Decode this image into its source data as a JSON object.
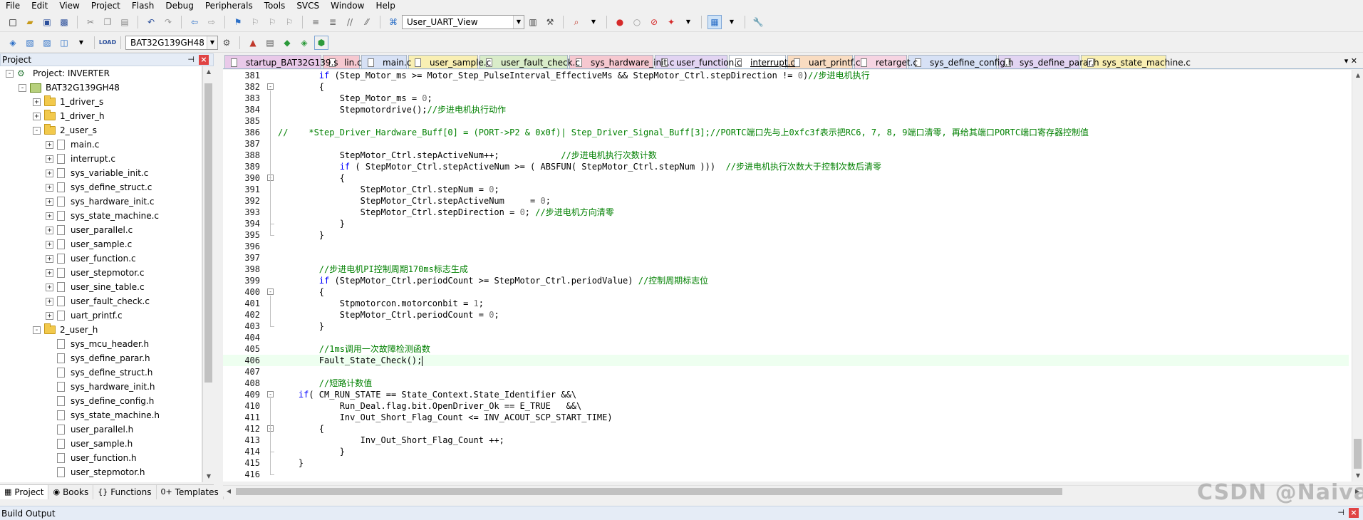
{
  "menu": [
    "File",
    "Edit",
    "View",
    "Project",
    "Flash",
    "Debug",
    "Peripherals",
    "Tools",
    "SVCS",
    "Window",
    "Help"
  ],
  "toolbar1": {
    "target_combo": "User_UART_View",
    "icons": [
      "new-file-icon",
      "open-file-icon",
      "save-icon",
      "save-all-icon",
      "cut-icon",
      "copy-icon",
      "paste-icon",
      "undo-icon",
      "redo-icon",
      "nav-back-icon",
      "nav-forward-icon",
      "bookmark-icon",
      "bookmark-prev-icon",
      "bookmark-next-icon",
      "bookmark-clear-icon",
      "indent-icon",
      "unindent-icon",
      "comment-icon",
      "uncomment-icon"
    ]
  },
  "toolbar2": {
    "target_combo": "BAT32G139GH48",
    "load_label": "LOAD"
  },
  "project_pane": {
    "title": "Project",
    "tree": [
      {
        "label": "Project: INVERTER",
        "level": 0,
        "kind": "project",
        "expanded": "-"
      },
      {
        "label": "BAT32G139GH48",
        "level": 1,
        "kind": "target",
        "expanded": "-"
      },
      {
        "label": "1_driver_s",
        "level": 2,
        "kind": "folder",
        "expanded": "+"
      },
      {
        "label": "1_driver_h",
        "level": 2,
        "kind": "folder",
        "expanded": "+"
      },
      {
        "label": "2_user_s",
        "level": 2,
        "kind": "folder",
        "expanded": "-"
      },
      {
        "label": "main.c",
        "level": 3,
        "kind": "file",
        "expanded": "+"
      },
      {
        "label": "interrupt.c",
        "level": 3,
        "kind": "file",
        "expanded": "+"
      },
      {
        "label": "sys_variable_init.c",
        "level": 3,
        "kind": "file",
        "expanded": "+"
      },
      {
        "label": "sys_define_struct.c",
        "level": 3,
        "kind": "file",
        "expanded": "+"
      },
      {
        "label": "sys_hardware_init.c",
        "level": 3,
        "kind": "file",
        "expanded": "+"
      },
      {
        "label": "sys_state_machine.c",
        "level": 3,
        "kind": "file",
        "expanded": "+"
      },
      {
        "label": "user_parallel.c",
        "level": 3,
        "kind": "file",
        "expanded": "+"
      },
      {
        "label": "user_sample.c",
        "level": 3,
        "kind": "file",
        "expanded": "+"
      },
      {
        "label": "user_function.c",
        "level": 3,
        "kind": "file",
        "expanded": "+"
      },
      {
        "label": "user_stepmotor.c",
        "level": 3,
        "kind": "file",
        "expanded": "+"
      },
      {
        "label": "user_sine_table.c",
        "level": 3,
        "kind": "file",
        "expanded": "+"
      },
      {
        "label": "user_fault_check.c",
        "level": 3,
        "kind": "file",
        "expanded": "+"
      },
      {
        "label": "uart_printf.c",
        "level": 3,
        "kind": "file",
        "expanded": "+"
      },
      {
        "label": "2_user_h",
        "level": 2,
        "kind": "folder",
        "expanded": "-"
      },
      {
        "label": "sys_mcu_header.h",
        "level": 3,
        "kind": "file",
        "expanded": ""
      },
      {
        "label": "sys_define_parar.h",
        "level": 3,
        "kind": "file",
        "expanded": ""
      },
      {
        "label": "sys_define_struct.h",
        "level": 3,
        "kind": "file",
        "expanded": ""
      },
      {
        "label": "sys_hardware_init.h",
        "level": 3,
        "kind": "file",
        "expanded": ""
      },
      {
        "label": "sys_define_config.h",
        "level": 3,
        "kind": "file",
        "expanded": ""
      },
      {
        "label": "sys_state_machine.h",
        "level": 3,
        "kind": "file",
        "expanded": ""
      },
      {
        "label": "user_parallel.h",
        "level": 3,
        "kind": "file",
        "expanded": ""
      },
      {
        "label": "user_sample.h",
        "level": 3,
        "kind": "file",
        "expanded": ""
      },
      {
        "label": "user_function.h",
        "level": 3,
        "kind": "file",
        "expanded": ""
      },
      {
        "label": "user_stepmotor.h",
        "level": 3,
        "kind": "file",
        "expanded": ""
      }
    ]
  },
  "bottom_tabs": [
    {
      "label": "Project",
      "icon": "▦",
      "active": true
    },
    {
      "label": "Books",
      "icon": "◉",
      "active": false
    },
    {
      "label": "Functions",
      "icon": "{}",
      "active": false
    },
    {
      "label": "Templates",
      "icon": "0+",
      "active": false
    }
  ],
  "build_output": {
    "title": "Build Output"
  },
  "editor_tabs": [
    {
      "label": "startup_BAT32G139.s",
      "color": "#e9c9e9",
      "active": false
    },
    {
      "label": "lin.c",
      "color": "#f6c8d0",
      "active": false
    },
    {
      "label": "main.c",
      "color": "#d7e1f5",
      "active": false
    },
    {
      "label": "user_sample.c",
      "color": "#f9efb3",
      "active": false
    },
    {
      "label": "user_fault_check.c",
      "color": "#d9ecc9",
      "active": false
    },
    {
      "label": "sys_hardware_init.c",
      "color": "#f6c8d0",
      "active": false
    },
    {
      "label": "user_function.c",
      "color": "#e2d4f2",
      "active": false
    },
    {
      "label": "interrupt.c",
      "color": "#d5f0e4",
      "active": true
    },
    {
      "label": "uart_printf.c",
      "color": "#f9dcc1",
      "active": false
    },
    {
      "label": "retarget.c",
      "color": "#f6d4e2",
      "active": false
    },
    {
      "label": "sys_define_config.h",
      "color": "#d7e1f5",
      "active": false
    },
    {
      "label": "sys_define_parar.h",
      "color": "#e2d4f2",
      "active": false
    },
    {
      "label": "sys_state_machine.c",
      "color": "#f9efb3",
      "active": false
    }
  ],
  "code_lines": [
    {
      "n": "381",
      "fold": "",
      "segs": [
        [
          "        ",
          ""
        ],
        [
          "if",
          "k"
        ],
        [
          " (Step_Motor_ms >= Motor_Step_PulseInterval_EffectiveMs && StepMotor_Ctrl.stepDirection != ",
          ""
        ],
        [
          "0",
          "n"
        ],
        [
          ")",
          ""
        ],
        [
          "//步进电机执行",
          "c"
        ]
      ]
    },
    {
      "n": "382",
      "fold": "-",
      "segs": [
        [
          "        {",
          ""
        ]
      ]
    },
    {
      "n": "383",
      "fold": "",
      "segs": [
        [
          "            Step_Motor_ms = ",
          ""
        ],
        [
          "0",
          "n"
        ],
        [
          ";",
          ""
        ]
      ]
    },
    {
      "n": "384",
      "fold": "",
      "segs": [
        [
          "            Stepmotordrive();",
          ""
        ],
        [
          "//步进电机执行动作",
          "c"
        ]
      ]
    },
    {
      "n": "385",
      "fold": "",
      "segs": []
    },
    {
      "n": "386",
      "fold": "",
      "segs": [
        [
          "//    *Step_Driver_Hardware_Buff[0] = (PORT->P2 & 0x0f)| Step_Driver_Signal_Buff[3];//PORTC端口先与上0xfc3f表示把RC6, 7, 8, 9端口清零, 再给其端口PORTC端口寄存器控制值",
          "c"
        ]
      ]
    },
    {
      "n": "387",
      "fold": "",
      "segs": []
    },
    {
      "n": "388",
      "fold": "",
      "segs": [
        [
          "            StepMotor_Ctrl.stepActiveNum++;            ",
          ""
        ],
        [
          "//步进电机执行次数计数",
          "c"
        ]
      ]
    },
    {
      "n": "389",
      "fold": "",
      "segs": [
        [
          "            ",
          ""
        ],
        [
          "if",
          "k"
        ],
        [
          " ( StepMotor_Ctrl.stepActiveNum >= ( ABSFUN( StepMotor_Ctrl.stepNum )))  ",
          ""
        ],
        [
          "//步进电机执行次数大于控制次数后清零",
          "c"
        ]
      ]
    },
    {
      "n": "390",
      "fold": "-",
      "segs": [
        [
          "            {",
          ""
        ]
      ]
    },
    {
      "n": "391",
      "fold": "",
      "segs": [
        [
          "                StepMotor_Ctrl.stepNum = ",
          ""
        ],
        [
          "0",
          "n"
        ],
        [
          ";",
          ""
        ]
      ]
    },
    {
      "n": "392",
      "fold": "",
      "segs": [
        [
          "                StepMotor_Ctrl.stepActiveNum     = ",
          ""
        ],
        [
          "0",
          "n"
        ],
        [
          ";",
          ""
        ]
      ]
    },
    {
      "n": "393",
      "fold": "",
      "segs": [
        [
          "                StepMotor_Ctrl.stepDirection = ",
          ""
        ],
        [
          "0",
          "n"
        ],
        [
          "; ",
          ""
        ],
        [
          "//步进电机方向清零",
          "c"
        ]
      ]
    },
    {
      "n": "394",
      "fold": "",
      "segs": [
        [
          "            }",
          ""
        ]
      ]
    },
    {
      "n": "395",
      "fold": "",
      "segs": [
        [
          "        }",
          ""
        ]
      ]
    },
    {
      "n": "396",
      "fold": "",
      "segs": []
    },
    {
      "n": "397",
      "fold": "",
      "segs": []
    },
    {
      "n": "398",
      "fold": "",
      "segs": [
        [
          "        ",
          ""
        ],
        [
          "//步进电机PI控制周期170ms标志生成",
          "c"
        ]
      ]
    },
    {
      "n": "399",
      "fold": "",
      "segs": [
        [
          "        ",
          ""
        ],
        [
          "if",
          "k"
        ],
        [
          " (StepMotor_Ctrl.periodCount >= StepMotor_Ctrl.periodValue) ",
          ""
        ],
        [
          "//控制周期标志位",
          "c"
        ]
      ]
    },
    {
      "n": "400",
      "fold": "-",
      "segs": [
        [
          "        {",
          ""
        ]
      ]
    },
    {
      "n": "401",
      "fold": "",
      "segs": [
        [
          "            Stpmotorcon.motorconbit = ",
          ""
        ],
        [
          "1",
          "n"
        ],
        [
          ";",
          ""
        ]
      ]
    },
    {
      "n": "402",
      "fold": "",
      "segs": [
        [
          "            StepMotor_Ctrl.periodCount = ",
          ""
        ],
        [
          "0",
          "n"
        ],
        [
          ";",
          ""
        ]
      ]
    },
    {
      "n": "403",
      "fold": "",
      "segs": [
        [
          "        }",
          ""
        ]
      ]
    },
    {
      "n": "404",
      "fold": "",
      "segs": []
    },
    {
      "n": "405",
      "fold": "",
      "segs": [
        [
          "        ",
          ""
        ],
        [
          "//1ms调用一次故障检测函数",
          "c"
        ]
      ]
    },
    {
      "n": "406",
      "fold": "",
      "segs": [
        [
          "        Fault_State_Check();",
          ""
        ]
      ],
      "current": true
    },
    {
      "n": "407",
      "fold": "",
      "segs": []
    },
    {
      "n": "408",
      "fold": "",
      "segs": [
        [
          "        ",
          ""
        ],
        [
          "//短路计数值",
          "c"
        ]
      ]
    },
    {
      "n": "409",
      "fold": "-",
      "segs": [
        [
          "    ",
          ""
        ],
        [
          "if",
          "k"
        ],
        [
          "( CM_RUN_STATE == State_Context.State_Identifier &&\\",
          ""
        ]
      ]
    },
    {
      "n": "410",
      "fold": "",
      "segs": [
        [
          "            Run_Deal.flag.bit.OpenDriver_Ok == E_TRUE   &&\\",
          ""
        ]
      ]
    },
    {
      "n": "411",
      "fold": "",
      "segs": [
        [
          "            Inv_Out_Short_Flag_Count <= INV_ACOUT_SCP_START_TIME)",
          ""
        ]
      ]
    },
    {
      "n": "412",
      "fold": "-",
      "segs": [
        [
          "        {",
          ""
        ]
      ]
    },
    {
      "n": "413",
      "fold": "",
      "segs": [
        [
          "                Inv_Out_Short_Flag_Count ++;",
          ""
        ]
      ]
    },
    {
      "n": "414",
      "fold": "",
      "segs": [
        [
          "            }",
          ""
        ]
      ]
    },
    {
      "n": "415",
      "fold": "",
      "segs": [
        [
          "    }",
          ""
        ]
      ]
    },
    {
      "n": "416",
      "fold": "",
      "segs": []
    }
  ],
  "watermark": "CSDN @Naiva"
}
